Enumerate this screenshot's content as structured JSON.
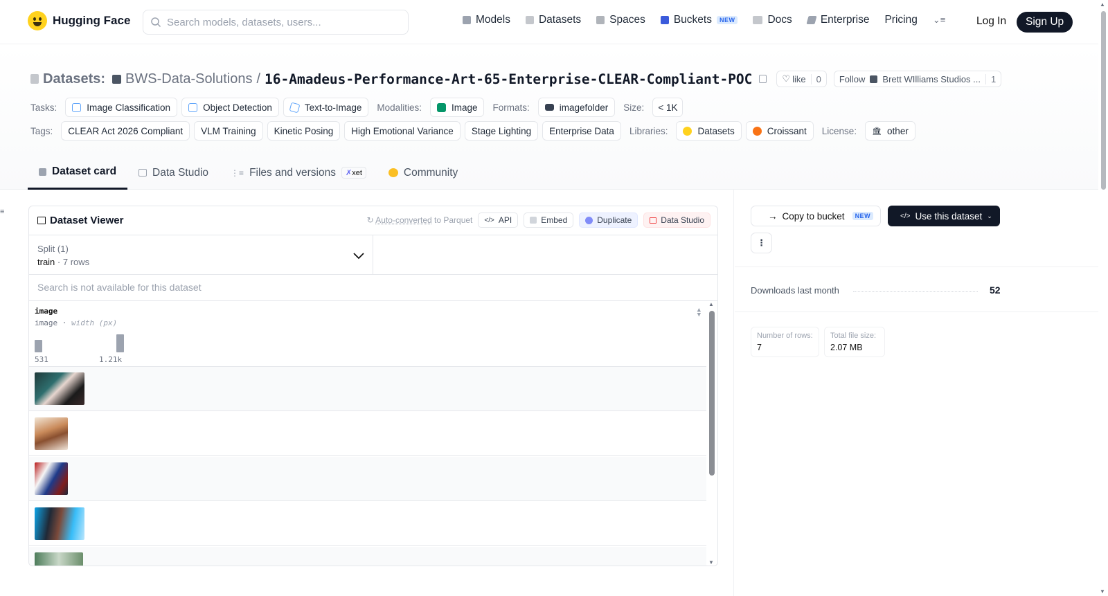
{
  "nav": {
    "brand": "Hugging Face",
    "search_placeholder": "Search models, datasets, users...",
    "links": {
      "models": "Models",
      "datasets": "Datasets",
      "spaces": "Spaces",
      "buckets": "Buckets",
      "buckets_badge": "NEW",
      "docs": "Docs",
      "enterprise": "Enterprise",
      "pricing": "Pricing"
    },
    "login": "Log In",
    "signup": "Sign Up"
  },
  "header": {
    "section_label": "Datasets:",
    "org": "BWS-Data-Solutions",
    "separator": "/",
    "repo_name": "16-Amadeus-Performance-Art-65-Enterprise-CLEAR-Compliant-POC",
    "like_label": "like",
    "like_count": "0",
    "follow_label": "Follow",
    "follow_name": "Brett WIlliams Studios ...",
    "follow_count": "1"
  },
  "metadata": {
    "tasks_label": "Tasks:",
    "tasks": [
      "Image Classification",
      "Object Detection",
      "Text-to-Image"
    ],
    "modalities_label": "Modalities:",
    "modality": "Image",
    "formats_label": "Formats:",
    "format": "imagefolder",
    "size_label": "Size:",
    "size": "< 1K",
    "tags_label": "Tags:",
    "tags": [
      "CLEAR Act 2026 Compliant",
      "VLM Training",
      "Kinetic Posing",
      "High Emotional Variance",
      "Stage Lighting",
      "Enterprise Data"
    ],
    "libraries_label": "Libraries:",
    "libraries": [
      "Datasets",
      "Croissant"
    ],
    "license_label": "License:",
    "license": "other"
  },
  "tabs": {
    "dataset_card": "Dataset card",
    "data_studio": "Data Studio",
    "files": "Files and versions",
    "files_badge": "xet",
    "community": "Community"
  },
  "viewer": {
    "title": "Dataset Viewer",
    "auto_converted": "Auto-converted",
    "auto_suffix": " to Parquet",
    "api": "API",
    "embed": "Embed",
    "duplicate": "Duplicate",
    "data_studio": "Data Studio",
    "split_label": "Split (1)",
    "split_name": "train",
    "split_rows": "7 rows",
    "search_na": "Search is not available for this dataset",
    "column": {
      "name": "image",
      "type": "image",
      "stat": "width (px)",
      "min": "531",
      "max": "1.21k"
    }
  },
  "sidebar": {
    "copy_bucket": "Copy to bucket",
    "copy_badge": "NEW",
    "use_dataset": "Use this dataset",
    "downloads_label": "Downloads last month",
    "downloads_value": "52",
    "rows_label": "Number of rows:",
    "rows_value": "7",
    "size_label": "Total file size:",
    "size_value": "2.07 MB"
  },
  "colors": {
    "brand_yellow": "#ffd21e",
    "dark": "#111827",
    "new_badge": "#2563eb"
  }
}
